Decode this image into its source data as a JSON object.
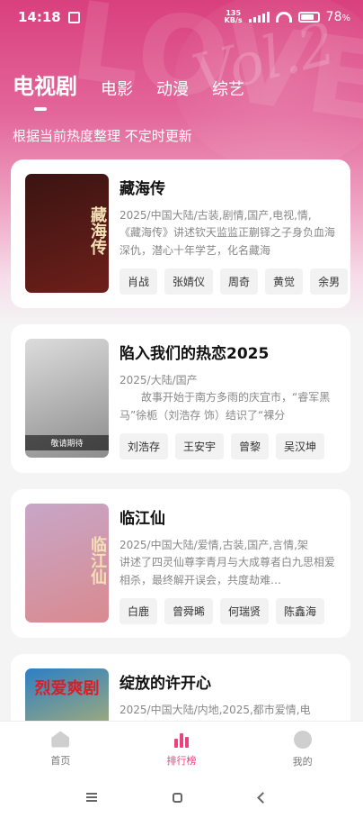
{
  "status": {
    "time": "14:18",
    "speed_top": "135",
    "speed_bottom": "KB/s",
    "battery": "78"
  },
  "tabs": [
    "电视剧",
    "电影",
    "动漫",
    "综艺"
  ],
  "subtitle": "根据当前热度整理 不定时更新",
  "items": [
    {
      "title": "藏海传",
      "meta": "2025/中国大陆/古装,剧情,国产,电视,情,",
      "desc": "《藏海传》讲述钦天监监正蒯铎之子身负血海深仇，潜心十年学艺，化名藏海",
      "actors": [
        "肖战",
        "张婧仪",
        "周奇",
        "黄觉",
        "余男"
      ],
      "poster_text": "藏海传",
      "poster_tag": "",
      "poster_colors": [
        "#3a1412",
        "#6e1f1a"
      ]
    },
    {
      "title": "陷入我们的热恋2025",
      "meta": "2025/大陆/国产",
      "desc": "　　故事开始于南方多雨的庆宜市，“睿军黑马”徐栀（刘浩存 饰）结识了“裸分",
      "actors": [
        "刘浩存",
        "王安宇",
        "曾黎",
        "吴汉坤"
      ],
      "poster_text": "",
      "poster_tag": "敬请期待",
      "poster_colors": [
        "#dcdcdc",
        "#8c8c8c"
      ]
    },
    {
      "title": "临江仙",
      "meta": "2025/中国大陆/爱情,古装,国产,言情,架",
      "desc": "讲述了四灵仙尊李青月与大成尊者白九思相爱相杀，最终解开误会，共度劫难…",
      "actors": [
        "白鹿",
        "曾舜晞",
        "何瑞贤",
        "陈鑫海"
      ],
      "poster_text": "临江仙",
      "poster_tag": "",
      "poster_colors": [
        "#c8a6c8",
        "#d98a8f"
      ]
    },
    {
      "title": "绽放的许开心",
      "meta": "2025/中国大陆/内地,2025,都市爱情,电",
      "desc": "",
      "actors": [],
      "poster_text": "烈爱爽剧",
      "poster_tag": "",
      "poster_colors": [
        "#2c7fc4",
        "#f0c84a"
      ]
    }
  ],
  "bottom_nav": [
    {
      "label": "首页",
      "icon": "home-icon",
      "active": false
    },
    {
      "label": "排行榜",
      "icon": "ranking-icon",
      "active": true
    },
    {
      "label": "我的",
      "icon": "profile-icon",
      "active": false
    }
  ],
  "colors": {
    "accent": "#e8437a",
    "hero_top": "#d9407d"
  }
}
